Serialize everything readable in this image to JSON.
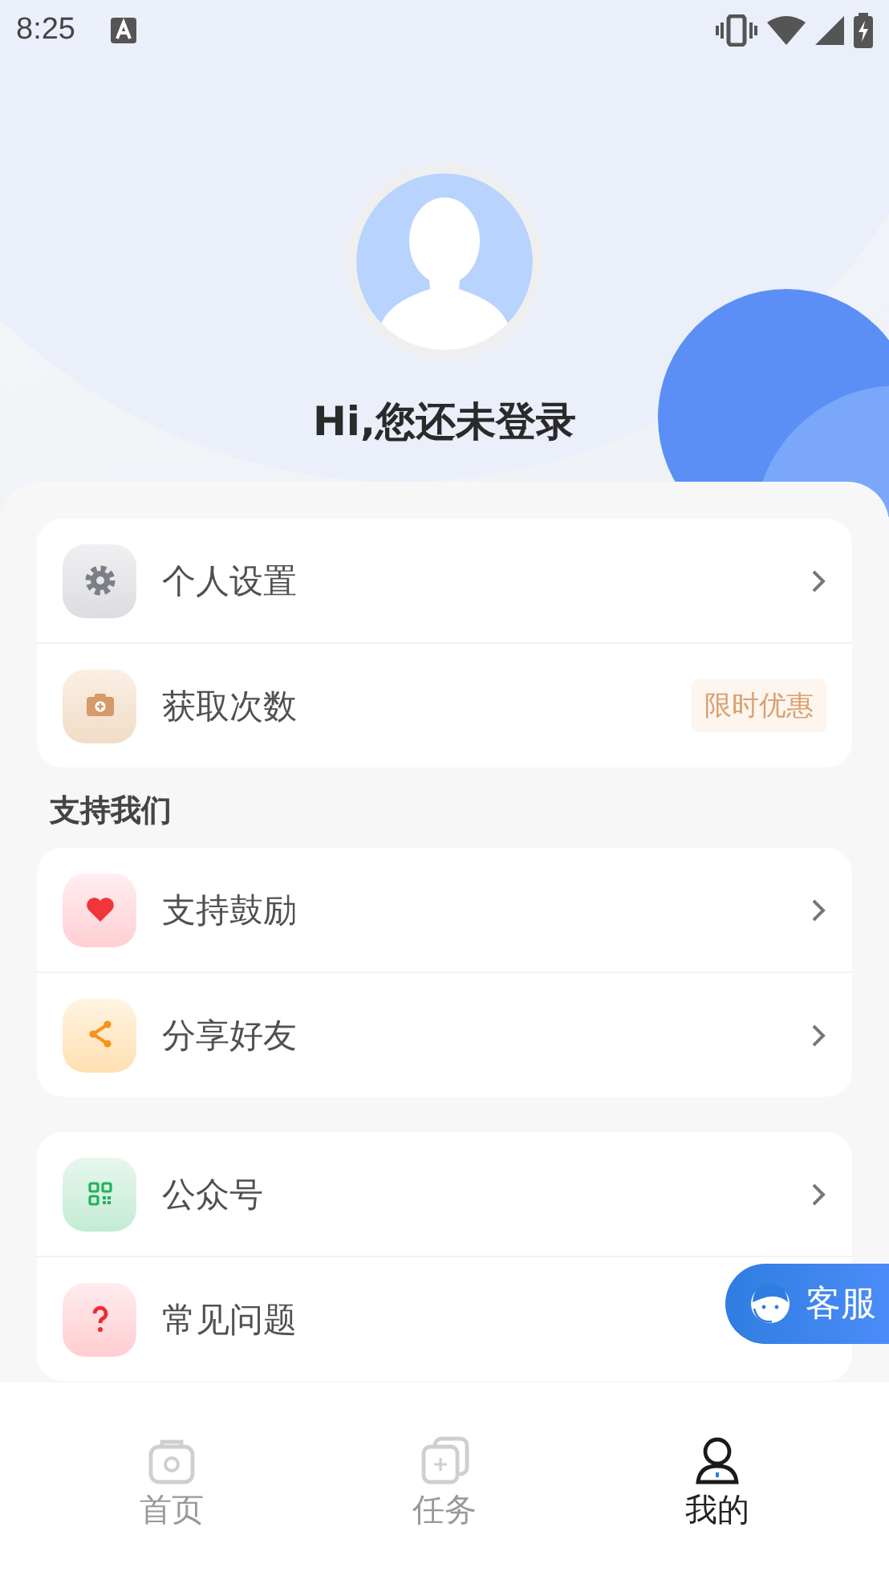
{
  "status_bar": {
    "time": "8:25"
  },
  "profile": {
    "greeting": "Hi,您还未登录"
  },
  "groups": [
    {
      "items": [
        {
          "kind": "gear",
          "label": "个人设置",
          "chevron": true
        },
        {
          "kind": "camera",
          "label": "获取次数",
          "badge": "限时优惠",
          "chevron": false
        }
      ]
    },
    {
      "title": "支持我们",
      "items": [
        {
          "kind": "heart",
          "label": "支持鼓励",
          "chevron": true
        },
        {
          "kind": "share",
          "label": "分享好友",
          "chevron": true
        }
      ]
    },
    {
      "items": [
        {
          "kind": "qr",
          "label": "公众号",
          "chevron": true
        },
        {
          "kind": "question",
          "label": "常见问题",
          "chevron": false
        }
      ]
    }
  ],
  "service_button": {
    "label": "客服"
  },
  "tabs": [
    {
      "kind": "home",
      "label": "首页",
      "selected": false
    },
    {
      "kind": "tasks",
      "label": "任务",
      "selected": false
    },
    {
      "kind": "profile",
      "label": "我的",
      "selected": true
    }
  ]
}
